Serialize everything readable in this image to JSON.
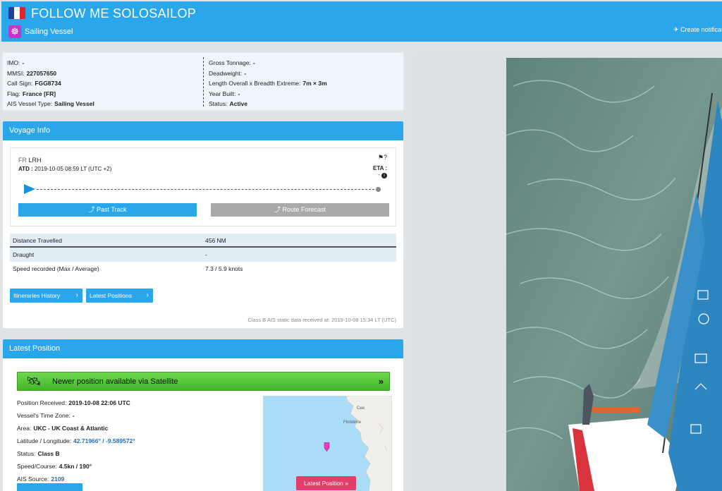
{
  "header": {
    "title": "FOLLOW ME SOLOSAILOP",
    "vessel_category": "Sailing Vessel",
    "notification_label": "Create notification",
    "flag_country": "France",
    "flag_colors": [
      "#1f3f9e",
      "#ffffff",
      "#e0242e"
    ],
    "category_icon": "sailboat-icon",
    "category_color": "#c236c8"
  },
  "particulars": {
    "left": [
      {
        "label": "IMO:",
        "value": "-"
      },
      {
        "label": "MMSI:",
        "value": "227057650"
      },
      {
        "label": "Call Sign:",
        "value": "FGG8734"
      },
      {
        "label": "Flag:",
        "value": "France [FR]"
      },
      {
        "label": "AIS Vessel Type:",
        "value": "Sailing Vessel"
      }
    ],
    "right": [
      {
        "label": "Gross Tonnage:",
        "value": "-"
      },
      {
        "label": "Deadweight:",
        "value": "-"
      },
      {
        "label": "Length Overall x Breadth Extreme:",
        "value": "7m × 3m"
      },
      {
        "label": "Year Built:",
        "value": "-"
      },
      {
        "label": "Status:",
        "value": "Active"
      }
    ]
  },
  "voyage": {
    "heading": "Voyage Info",
    "from_country": "FR",
    "from_port": "LRH",
    "atd_label": "ATD :",
    "atd_value": "2019-10-05 08:59 LT (UTC +2)",
    "eta_label": "ETA :",
    "eta_value": "-",
    "past_track_label": "Past Track",
    "route_forecast_label": "Route Forecast",
    "rows": [
      {
        "label": "Distance Travelled",
        "value": "456 NM"
      },
      {
        "label": "Draught",
        "value": "-"
      },
      {
        "label": "Speed recorded (Max / Average)",
        "value": "7.3 / 5.9 knots"
      }
    ],
    "itineraries_label": "Itineraries History",
    "latest_positions_label": "Latest Positions",
    "static_note": "Class B AIS static data received at: 2019-10-08 15:34 LT (UTC)"
  },
  "latest_position": {
    "heading": "Latest Position",
    "satellite_banner": "Newer position available via Satellite",
    "rows": [
      {
        "label": "Position Received:",
        "value": "2019-10-08 22:06 UTC"
      },
      {
        "label": "Vessel's Time Zone:",
        "value": "-"
      },
      {
        "label": "Area:",
        "value": "UKC - UK Coast & Atlantic"
      },
      {
        "label": "Latitude / Longitude:",
        "value": "42.71966° / -9.589572°",
        "link": true
      },
      {
        "label": "Status:",
        "value": "Class B"
      },
      {
        "label": "Speed/Course:",
        "value": "4.5kn / 190°"
      },
      {
        "label": "AIS Source:",
        "value": "2109",
        "link": true
      }
    ],
    "map": {
      "labels": [
        "Cee",
        "Finisterre"
      ],
      "button_label": "Latest Position",
      "vessel_color": "#e83fc2"
    }
  }
}
